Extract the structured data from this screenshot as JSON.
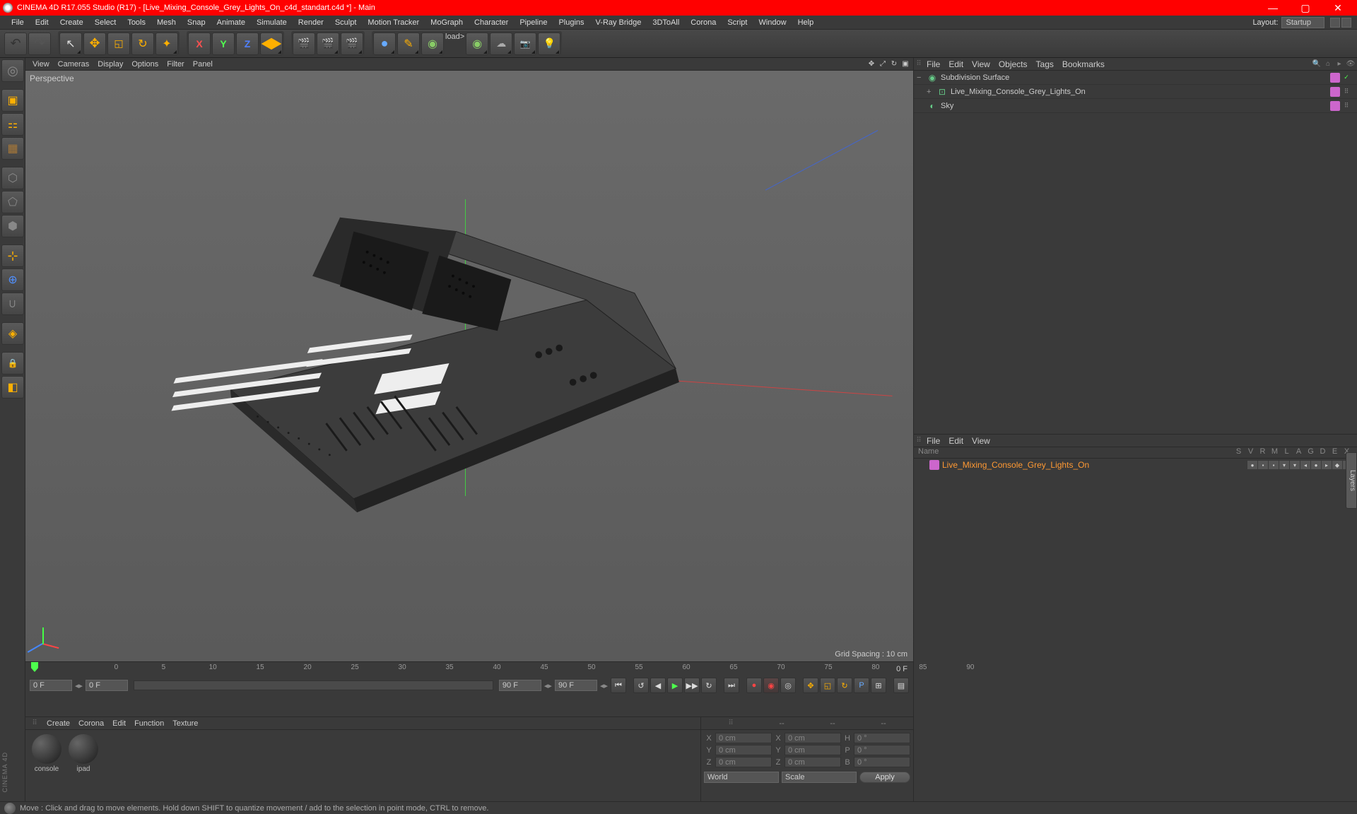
{
  "title": "CINEMA 4D R17.055 Studio (R17) - [Live_Mixing_Console_Grey_Lights_On_c4d_standart.c4d *] - Main",
  "menubar": [
    "File",
    "Edit",
    "Create",
    "Select",
    "Tools",
    "Mesh",
    "Snap",
    "Animate",
    "Simulate",
    "Render",
    "Sculpt",
    "Motion Tracker",
    "MoGraph",
    "Character",
    "Pipeline",
    "Plugins",
    "V-Ray Bridge",
    "3DToAll",
    "Corona",
    "Script",
    "Window",
    "Help"
  ],
  "layout": {
    "label": "Layout:",
    "value": "Startup"
  },
  "viewport": {
    "menu": [
      "View",
      "Cameras",
      "Display",
      "Options",
      "Filter",
      "Panel"
    ],
    "label": "Perspective",
    "gridinfo": "Grid Spacing : 10 cm"
  },
  "timeline": {
    "start": "0 F",
    "current": "0 F",
    "end": "90 F",
    "end2": "90 F",
    "ticks": [
      "0",
      "5",
      "10",
      "15",
      "20",
      "25",
      "30",
      "35",
      "40",
      "45",
      "50",
      "55",
      "60",
      "65",
      "70",
      "75",
      "80",
      "85",
      "90"
    ],
    "frame_end_label": "0 F"
  },
  "materials": {
    "menu": [
      "Create",
      "Corona",
      "Edit",
      "Function",
      "Texture"
    ],
    "items": [
      "console",
      "ipad"
    ]
  },
  "coords": {
    "hdr": [
      "--",
      "--",
      "--"
    ],
    "rows": [
      {
        "l": "X",
        "v1": "0 cm",
        "m": "X",
        "v2": "0 cm",
        "r": "H",
        "v3": "0 °"
      },
      {
        "l": "Y",
        "v1": "0 cm",
        "m": "Y",
        "v2": "0 cm",
        "r": "P",
        "v3": "0 °"
      },
      {
        "l": "Z",
        "v1": "0 cm",
        "m": "Z",
        "v2": "0 cm",
        "r": "B",
        "v3": "0 °"
      }
    ],
    "world": "World",
    "scale": "Scale",
    "apply": "Apply"
  },
  "objmgr": {
    "menu": [
      "File",
      "Edit",
      "View",
      "Objects",
      "Tags",
      "Bookmarks"
    ],
    "items": [
      {
        "icon": "subd",
        "label": "Subdivision Surface",
        "indent": 0,
        "expand": "−",
        "sel": false,
        "tags": [
          "mat",
          "vis"
        ]
      },
      {
        "icon": "null",
        "label": "Live_Mixing_Console_Grey_Lights_On",
        "indent": 1,
        "expand": "+",
        "sel": false,
        "tags": [
          "mat",
          "ctrl"
        ]
      },
      {
        "icon": "sky",
        "label": "Sky",
        "indent": 0,
        "expand": "",
        "sel": false,
        "tags": [
          "mat",
          "ctrl"
        ]
      }
    ]
  },
  "takemgr": {
    "menu": [
      "File",
      "Edit",
      "View"
    ],
    "cols": [
      "Name",
      "S",
      "V",
      "R",
      "M",
      "L",
      "A",
      "G",
      "D",
      "E",
      "X"
    ],
    "row": {
      "label": "Live_Mixing_Console_Grey_Lights_On"
    }
  },
  "statusbar": "Move : Click and drag to move elements. Hold down SHIFT to quantize movement / add to the selection in point mode, CTRL to remove.",
  "brand": "CINEMA 4D",
  "vtab": "Layers"
}
